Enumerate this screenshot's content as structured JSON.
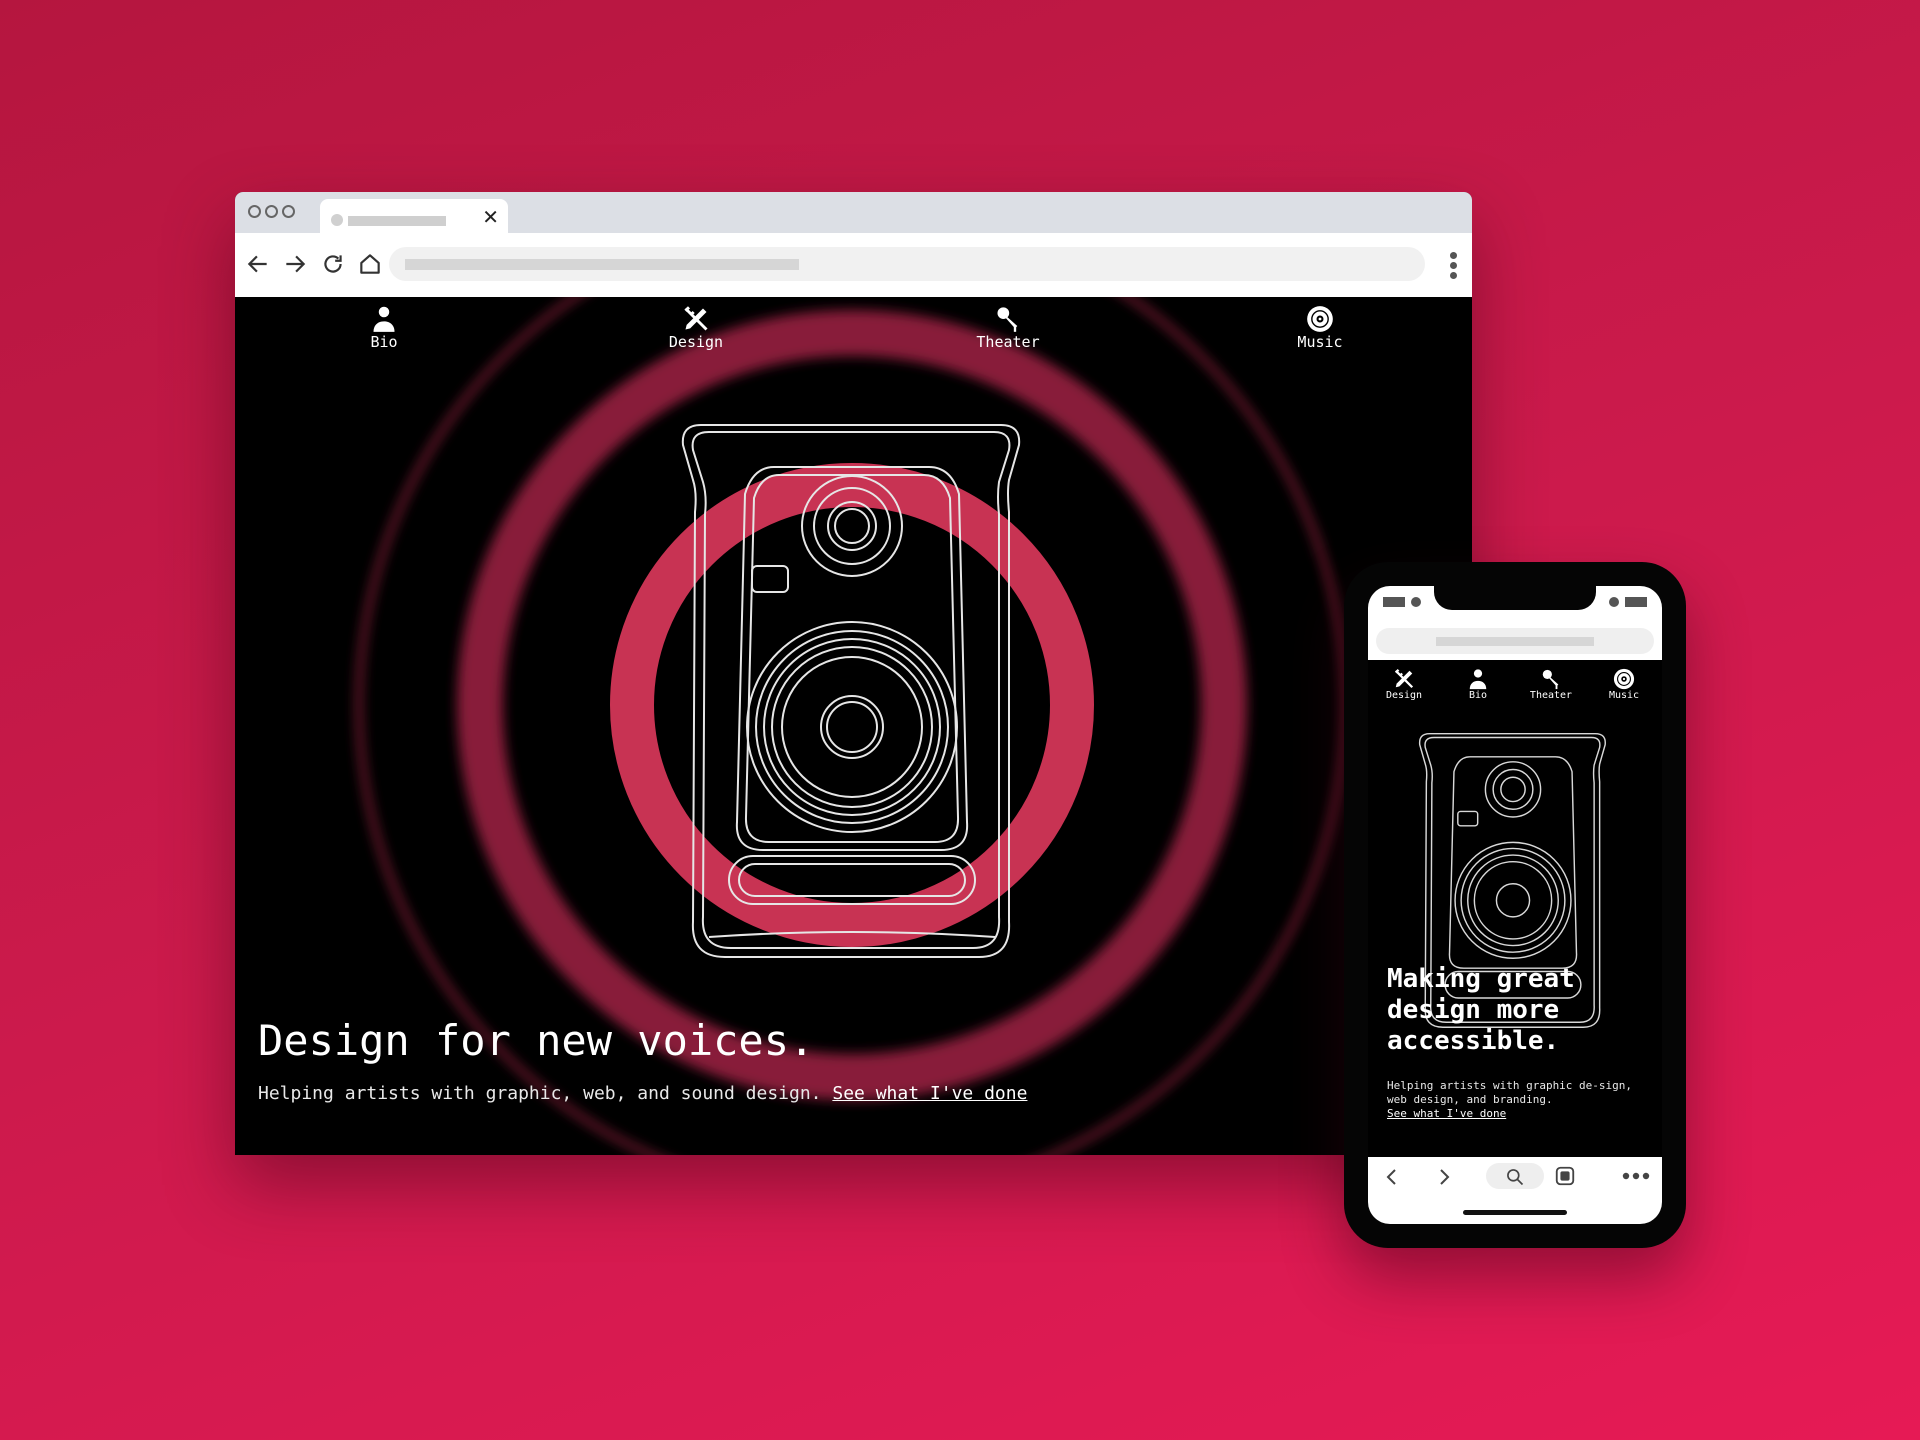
{
  "colors": {
    "background": "#cc1a4c",
    "accent": "#d93355",
    "site_background": "#000000"
  },
  "desktop": {
    "window_controls": [
      "circle",
      "circle",
      "circle"
    ],
    "tab": {
      "close_icon": "close-icon"
    },
    "toolbar_icons": [
      "back-arrow-icon",
      "forward-arrow-icon",
      "reload-icon",
      "home-icon",
      "more-vertical-icon"
    ],
    "nav": [
      {
        "label": "Bio",
        "icon": "person-icon"
      },
      {
        "label": "Design",
        "icon": "pencil-ruler-icon"
      },
      {
        "label": "Theater",
        "icon": "microphone-icon"
      },
      {
        "label": "Music",
        "icon": "vinyl-record-icon"
      }
    ],
    "hero": {
      "title": "Design for new voices.",
      "subtitle": "Helping artists with graphic, web, and sound design.",
      "link": "See what I've done"
    }
  },
  "mobile": {
    "nav": [
      {
        "label": "Design",
        "icon": "pencil-ruler-icon"
      },
      {
        "label": "Bio",
        "icon": "person-icon"
      },
      {
        "label": "Theater",
        "icon": "microphone-icon"
      },
      {
        "label": "Music",
        "icon": "vinyl-record-icon"
      }
    ],
    "hero": {
      "title": "Making great design more accessible.",
      "subtitle": "Helping artists with graphic de-sign, web design, and branding.",
      "link": "See what I've done"
    },
    "bottom_bar_icons": [
      "chevron-left-icon",
      "chevron-right-icon",
      "search-icon",
      "tabs-icon",
      "more-horizontal-icon"
    ]
  }
}
